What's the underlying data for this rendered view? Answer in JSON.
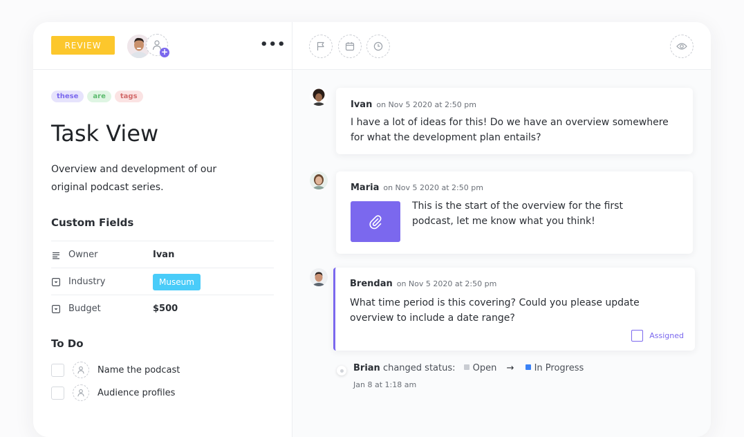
{
  "header": {
    "status_label": "REVIEW",
    "more_label": "•••"
  },
  "tags": [
    {
      "label": "these",
      "bg": "#e6e3fc",
      "color": "#7b68ee"
    },
    {
      "label": "are",
      "bg": "#dff5e3",
      "color": "#5cbb6e"
    },
    {
      "label": "tags",
      "bg": "#fbe3e3",
      "color": "#d26a6a"
    }
  ],
  "task": {
    "title": "Task View",
    "description": "Overview and development of our original podcast series."
  },
  "custom_fields": {
    "heading": "Custom Fields",
    "fields": [
      {
        "label": "Owner",
        "value": "Ivan",
        "icon": "text-lines-icon"
      },
      {
        "label": "Industry",
        "value": "Museum",
        "icon": "dropdown-icon"
      },
      {
        "label": "Budget",
        "value": "$500",
        "icon": "dropdown-icon"
      }
    ]
  },
  "todo": {
    "heading": "To Do",
    "items": [
      {
        "label": "Name the podcast"
      },
      {
        "label": "Audience profiles"
      }
    ]
  },
  "comments": [
    {
      "name": "Ivan",
      "time": "on Nov 5 2020 at 2:50 pm",
      "text": "I have a lot of ideas for this! Do we have an overview somewhere for what the development plan entails?"
    },
    {
      "name": "Maria",
      "time": "on Nov 5 2020 at 2:50 pm",
      "text": "This is the start of the overview for the first podcast, let me know what you think!"
    },
    {
      "name": "Brendan",
      "time": "on Nov 5 2020 at 2:50 pm",
      "text": "What time period is this covering? Could you please update overview to include a date range?",
      "assigned_label": "Assigned"
    }
  ],
  "activity": {
    "user": "Brian",
    "action": "changed status:",
    "from": "Open",
    "to": "In Progress",
    "from_color": "#c9ccd2",
    "to_color": "#3b82f6",
    "arrow": "→",
    "time": "Jan 8 at 1:18 am"
  },
  "colors": {
    "review": "#fcc72c",
    "accent": "#7b68ee",
    "museum": "#49ccf9"
  }
}
